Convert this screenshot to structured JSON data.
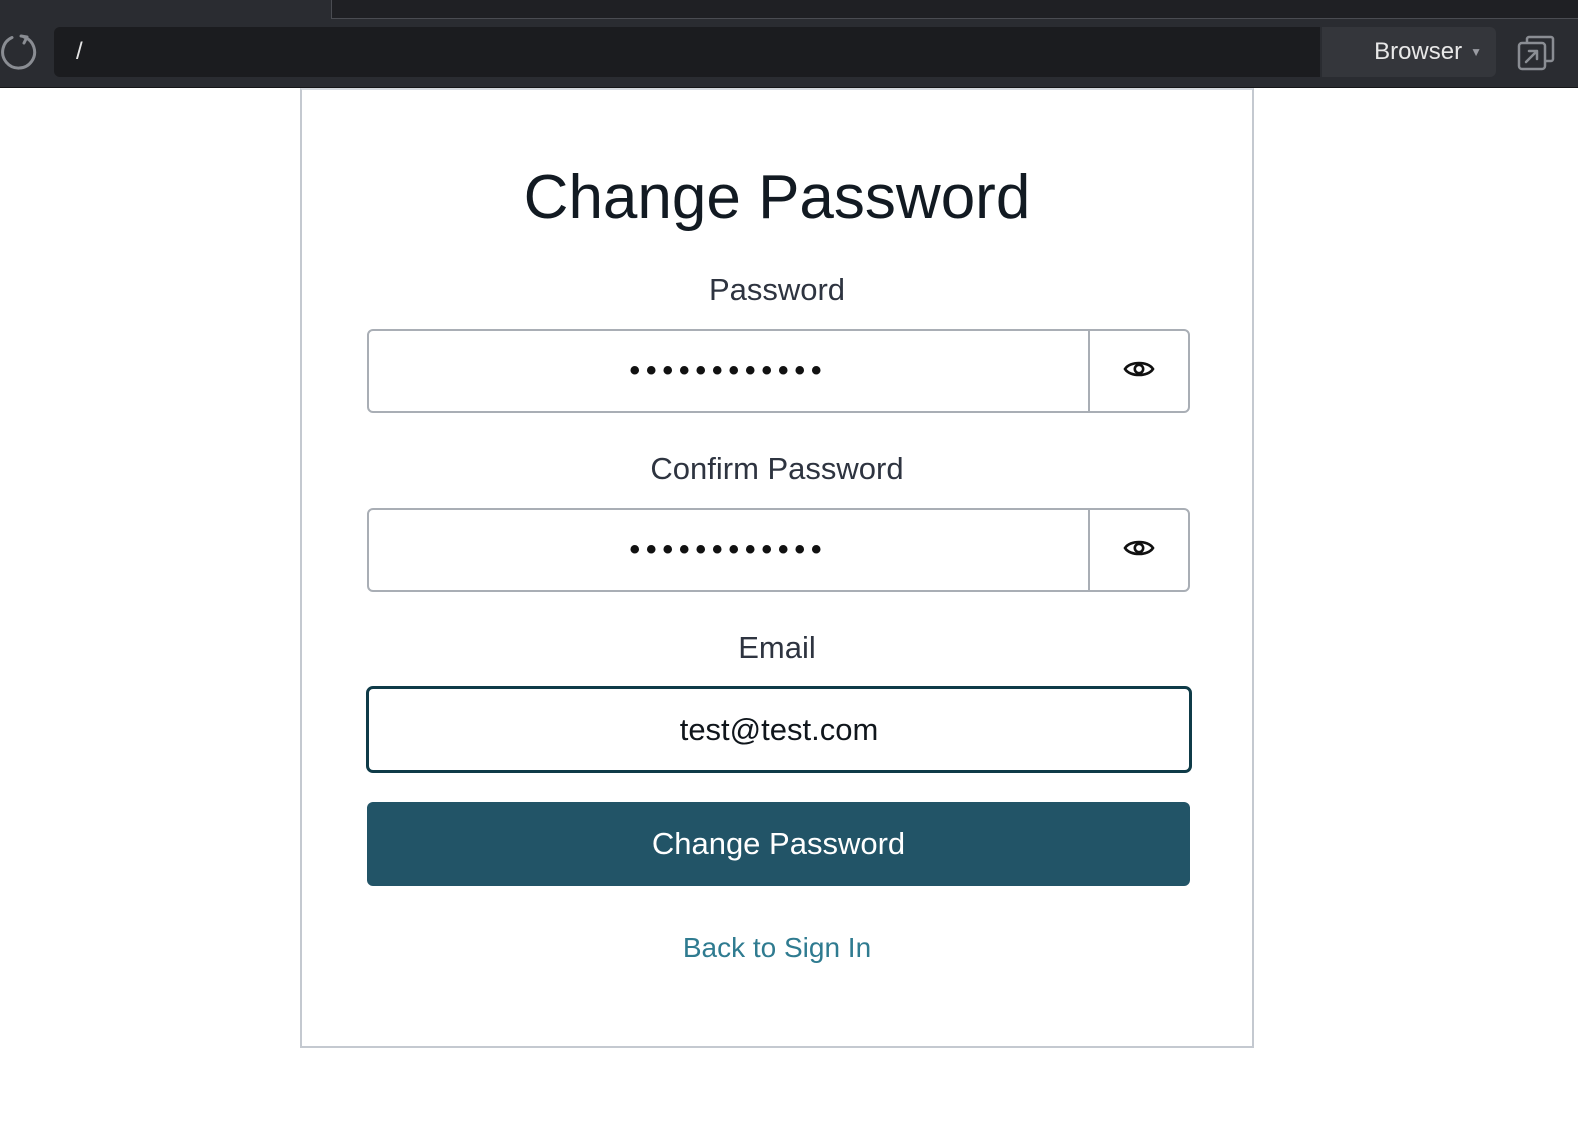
{
  "browser": {
    "address": "/",
    "browser_select_label": "Browser"
  },
  "form": {
    "title": "Change Password",
    "password_label": "Password",
    "password_value": "••••••••••••",
    "confirm_label": "Confirm Password",
    "confirm_value": "••••••••••••",
    "email_label": "Email",
    "email_value": "test@test.com",
    "submit_label": "Change Password",
    "back_link": "Back to Sign In"
  },
  "colors": {
    "primary": "#225467",
    "link": "#2f7b90",
    "focus_border": "#0f3b48"
  },
  "icons": {
    "reload": "reload-icon",
    "popout": "popout-icon",
    "password_toggle": "eye-icon",
    "caret": "chevron-down-icon"
  }
}
